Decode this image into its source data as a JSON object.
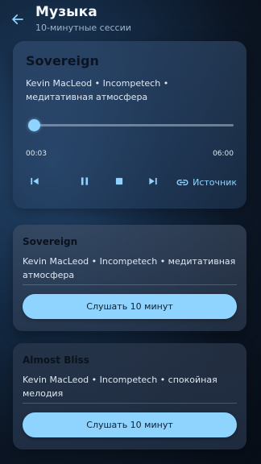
{
  "header": {
    "title": "Музыка",
    "subtitle": "10-минутные сессии",
    "back_icon": "arrow-left-icon"
  },
  "player": {
    "track_title": "Sovereign",
    "track_meta": "Kevin MacLeod • Incompetech • медитативная атмосфера",
    "current_time": "00:03",
    "total_time": "06:00",
    "progress_fraction": 0.01,
    "source_label": "Источник",
    "accent_color": "#8fd3ff"
  },
  "cards": [
    {
      "title": "Sovereign",
      "meta": "Kevin MacLeod • Incompetech • медитативная атмосфера",
      "button_label": "Слушать 10 минут"
    },
    {
      "title": "Almost Bliss",
      "meta": "Kevin MacLeod • Incompetech • спокойная мелодия",
      "button_label": "Слушать 10 минут"
    }
  ]
}
